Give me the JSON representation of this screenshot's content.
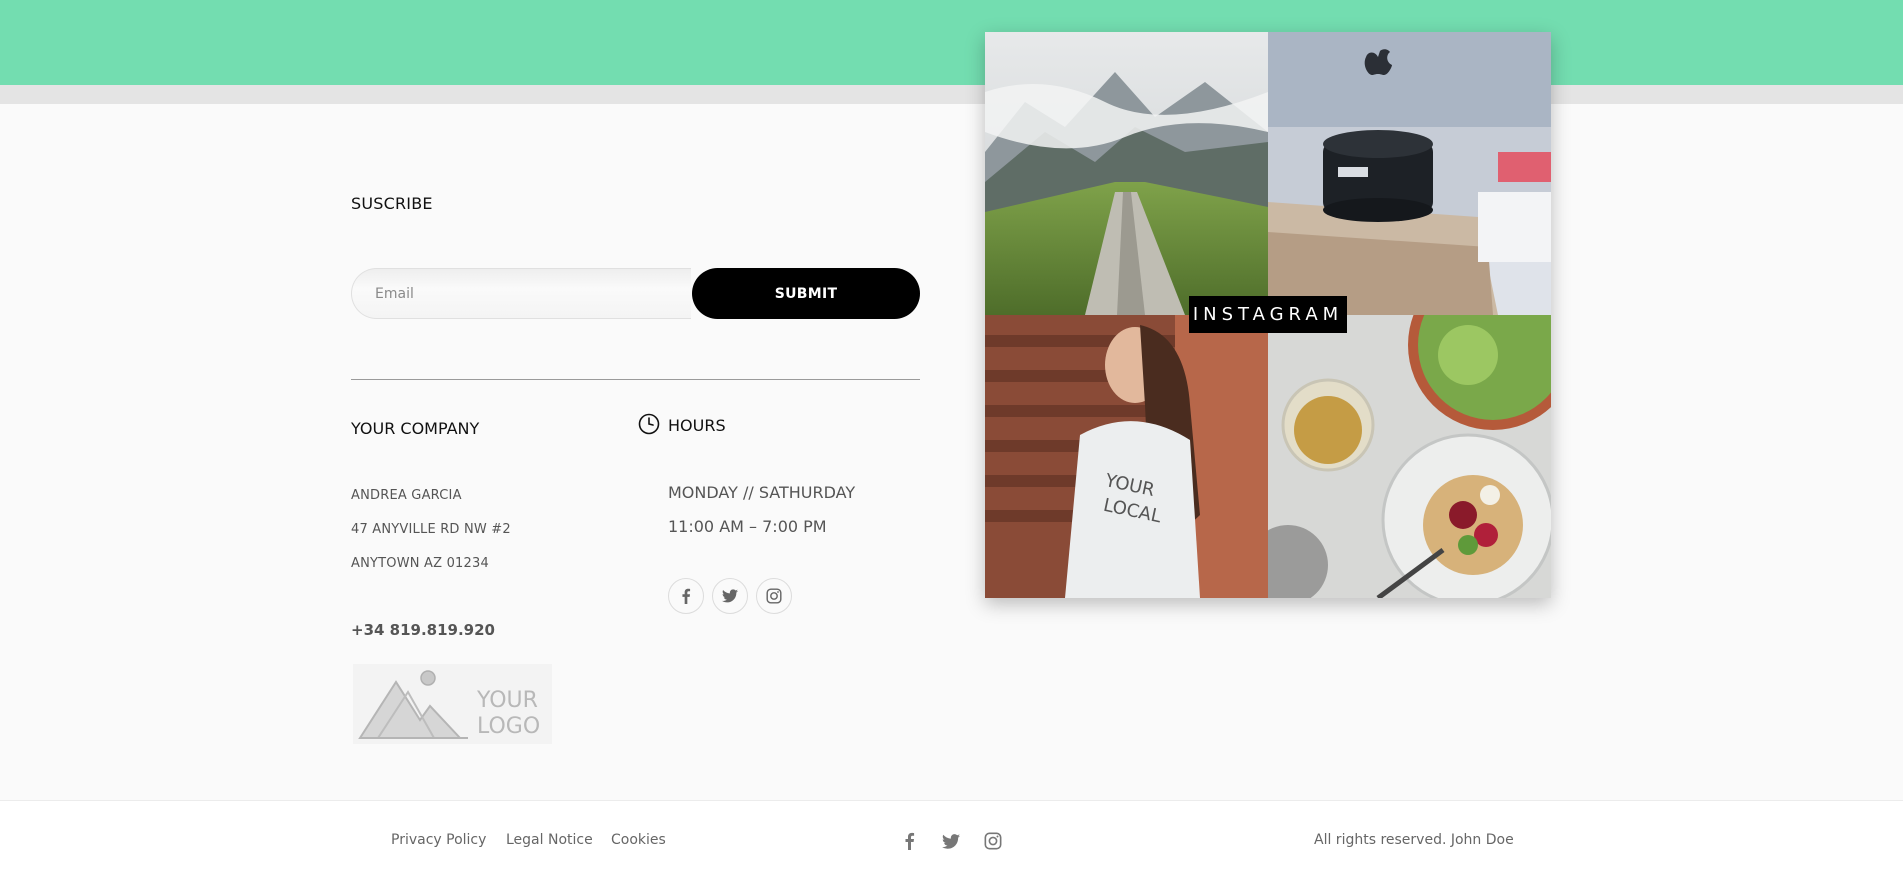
{
  "subscribe": {
    "title": "SUSCRIBE",
    "email_placeholder": "Email",
    "submit_label": "SUBMIT"
  },
  "company": {
    "title": "YOUR COMPANY",
    "name": "ANDREA GARCIA",
    "address_line1": "47 ANYVILLE RD NW #2",
    "address_line2": "ANYTOWN AZ 01234",
    "phone": "+34 819.819.920",
    "logo_line1": "YOUR",
    "logo_line2": "LOGO"
  },
  "hours": {
    "title": "HOURS",
    "days": "MONDAY // SATHURDAY",
    "time": "11:00 AM – 7:00 PM"
  },
  "instagram": {
    "label": "INSTAGRAM"
  },
  "footer": {
    "links": [
      "Privacy Policy",
      "Legal Notice",
      "Cookies"
    ],
    "copyright": "All rights reserved. John Doe"
  },
  "colors": {
    "accent": "#73ddb0",
    "button": "#000000"
  },
  "icons": [
    "clock-icon",
    "facebook-icon",
    "twitter-icon",
    "instagram-icon"
  ]
}
